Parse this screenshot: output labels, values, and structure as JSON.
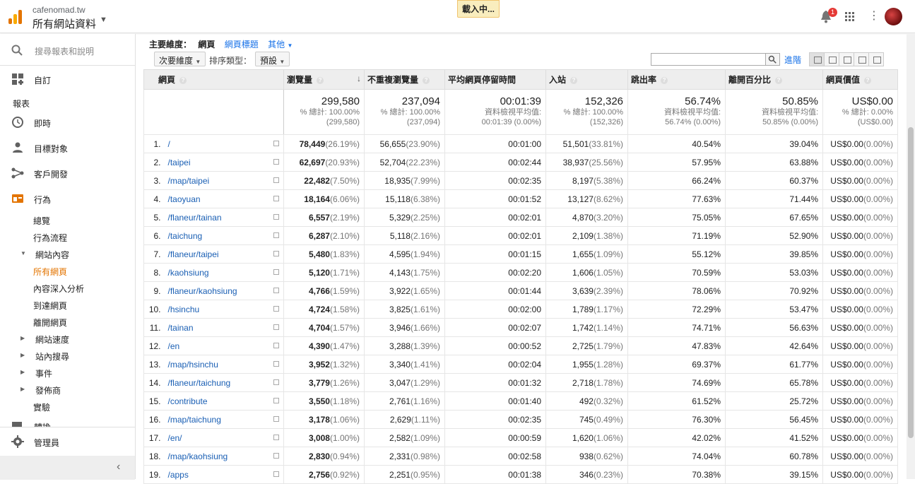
{
  "header": {
    "account": "cafenomad.tw",
    "property": "所有網站資料",
    "loading": "載入中...",
    "notif_count": "1"
  },
  "sidebar": {
    "search_placeholder": "搜尋報表和說明",
    "customize": "自訂",
    "reports_title": "報表",
    "realtime": "即時",
    "audience": "目標對象",
    "acquisition": "客戶開發",
    "behavior": "行為",
    "behavior_items": [
      "總覽",
      "行為流程",
      "網站內容",
      "所有網頁",
      "內容深入分析",
      "到達網頁",
      "離開網頁",
      "網站速度",
      "站內搜尋",
      "事件",
      "發佈商",
      "實驗"
    ],
    "conversions_partial": "轉換",
    "admin": "管理員"
  },
  "toolbar": {
    "primary_dim_label": "主要維度：",
    "primary_dim_current": "網頁",
    "primary_dim_alt": "網頁標題",
    "primary_dim_other": "其他",
    "secondary_dim": "次要維度",
    "sort_label": "排序類型：",
    "sort_value": "預設",
    "advanced": "進階"
  },
  "table": {
    "headers": [
      "網頁",
      "瀏覽量",
      "不重複瀏覽量",
      "平均網頁停留時間",
      "入站",
      "跳出率",
      "離開百分比",
      "網頁價值"
    ],
    "totals": {
      "pageviews": "299,580",
      "pageviews_sub1": "% 總計: 100.00%",
      "pageviews_sub2": "(299,580)",
      "unique": "237,094",
      "unique_sub1": "% 總計: 100.00%",
      "unique_sub2": "(237,094)",
      "avgtime": "00:01:39",
      "avgtime_sub1": "資料檢視平均值:",
      "avgtime_sub2": "00:01:39 (0.00%)",
      "entrances": "152,326",
      "entrances_sub1": "% 總計: 100.00%",
      "entrances_sub2": "(152,326)",
      "bounce": "56.74%",
      "bounce_sub1": "資料檢視平均值:",
      "bounce_sub2": "56.74% (0.00%)",
      "exit": "50.85%",
      "exit_sub1": "資料檢視平均值:",
      "exit_sub2": "50.85% (0.00%)",
      "value": "US$0.00",
      "value_sub1": "% 總計: 0.00%",
      "value_sub2": "(US$0.00)"
    },
    "rows": [
      {
        "idx": "1.",
        "page": "/",
        "pv": "78,449",
        "pvp": "(26.19%)",
        "up": "56,655",
        "upp": "(23.90%)",
        "t": "00:01:00",
        "en": "51,501",
        "enp": "(33.81%)",
        "br": "40.54%",
        "ex": "39.04%",
        "v": "US$0.00",
        "vp": "(0.00%)"
      },
      {
        "idx": "2.",
        "page": "/taipei",
        "pv": "62,697",
        "pvp": "(20.93%)",
        "up": "52,704",
        "upp": "(22.23%)",
        "t": "00:02:44",
        "en": "38,937",
        "enp": "(25.56%)",
        "br": "57.95%",
        "ex": "63.88%",
        "v": "US$0.00",
        "vp": "(0.00%)"
      },
      {
        "idx": "3.",
        "page": "/map/taipei",
        "pv": "22,482",
        "pvp": "(7.50%)",
        "up": "18,935",
        "upp": "(7.99%)",
        "t": "00:02:35",
        "en": "8,197",
        "enp": "(5.38%)",
        "br": "66.24%",
        "ex": "60.37%",
        "v": "US$0.00",
        "vp": "(0.00%)"
      },
      {
        "idx": "4.",
        "page": "/taoyuan",
        "pv": "18,164",
        "pvp": "(6.06%)",
        "up": "15,118",
        "upp": "(6.38%)",
        "t": "00:01:52",
        "en": "13,127",
        "enp": "(8.62%)",
        "br": "77.63%",
        "ex": "71.44%",
        "v": "US$0.00",
        "vp": "(0.00%)"
      },
      {
        "idx": "5.",
        "page": "/flaneur/tainan",
        "pv": "6,557",
        "pvp": "(2.19%)",
        "up": "5,329",
        "upp": "(2.25%)",
        "t": "00:02:01",
        "en": "4,870",
        "enp": "(3.20%)",
        "br": "75.05%",
        "ex": "67.65%",
        "v": "US$0.00",
        "vp": "(0.00%)"
      },
      {
        "idx": "6.",
        "page": "/taichung",
        "pv": "6,287",
        "pvp": "(2.10%)",
        "up": "5,118",
        "upp": "(2.16%)",
        "t": "00:02:01",
        "en": "2,109",
        "enp": "(1.38%)",
        "br": "71.19%",
        "ex": "52.90%",
        "v": "US$0.00",
        "vp": "(0.00%)"
      },
      {
        "idx": "7.",
        "page": "/flaneur/taipei",
        "pv": "5,480",
        "pvp": "(1.83%)",
        "up": "4,595",
        "upp": "(1.94%)",
        "t": "00:01:15",
        "en": "1,655",
        "enp": "(1.09%)",
        "br": "55.12%",
        "ex": "39.85%",
        "v": "US$0.00",
        "vp": "(0.00%)"
      },
      {
        "idx": "8.",
        "page": "/kaohsiung",
        "pv": "5,120",
        "pvp": "(1.71%)",
        "up": "4,143",
        "upp": "(1.75%)",
        "t": "00:02:20",
        "en": "1,606",
        "enp": "(1.05%)",
        "br": "70.59%",
        "ex": "53.03%",
        "v": "US$0.00",
        "vp": "(0.00%)"
      },
      {
        "idx": "9.",
        "page": "/flaneur/kaohsiung",
        "pv": "4,766",
        "pvp": "(1.59%)",
        "up": "3,922",
        "upp": "(1.65%)",
        "t": "00:01:44",
        "en": "3,639",
        "enp": "(2.39%)",
        "br": "78.06%",
        "ex": "70.92%",
        "v": "US$0.00",
        "vp": "(0.00%)"
      },
      {
        "idx": "10.",
        "page": "/hsinchu",
        "pv": "4,724",
        "pvp": "(1.58%)",
        "up": "3,825",
        "upp": "(1.61%)",
        "t": "00:02:00",
        "en": "1,789",
        "enp": "(1.17%)",
        "br": "72.29%",
        "ex": "53.47%",
        "v": "US$0.00",
        "vp": "(0.00%)"
      },
      {
        "idx": "11.",
        "page": "/tainan",
        "pv": "4,704",
        "pvp": "(1.57%)",
        "up": "3,946",
        "upp": "(1.66%)",
        "t": "00:02:07",
        "en": "1,742",
        "enp": "(1.14%)",
        "br": "74.71%",
        "ex": "56.63%",
        "v": "US$0.00",
        "vp": "(0.00%)"
      },
      {
        "idx": "12.",
        "page": "/en",
        "pv": "4,390",
        "pvp": "(1.47%)",
        "up": "3,288",
        "upp": "(1.39%)",
        "t": "00:00:52",
        "en": "2,725",
        "enp": "(1.79%)",
        "br": "47.83%",
        "ex": "42.64%",
        "v": "US$0.00",
        "vp": "(0.00%)"
      },
      {
        "idx": "13.",
        "page": "/map/hsinchu",
        "pv": "3,952",
        "pvp": "(1.32%)",
        "up": "3,340",
        "upp": "(1.41%)",
        "t": "00:02:04",
        "en": "1,955",
        "enp": "(1.28%)",
        "br": "69.37%",
        "ex": "61.77%",
        "v": "US$0.00",
        "vp": "(0.00%)"
      },
      {
        "idx": "14.",
        "page": "/flaneur/taichung",
        "pv": "3,779",
        "pvp": "(1.26%)",
        "up": "3,047",
        "upp": "(1.29%)",
        "t": "00:01:32",
        "en": "2,718",
        "enp": "(1.78%)",
        "br": "74.69%",
        "ex": "65.78%",
        "v": "US$0.00",
        "vp": "(0.00%)"
      },
      {
        "idx": "15.",
        "page": "/contribute",
        "pv": "3,550",
        "pvp": "(1.18%)",
        "up": "2,761",
        "upp": "(1.16%)",
        "t": "00:01:40",
        "en": "492",
        "enp": "(0.32%)",
        "br": "61.52%",
        "ex": "25.72%",
        "v": "US$0.00",
        "vp": "(0.00%)"
      },
      {
        "idx": "16.",
        "page": "/map/taichung",
        "pv": "3,178",
        "pvp": "(1.06%)",
        "up": "2,629",
        "upp": "(1.11%)",
        "t": "00:02:35",
        "en": "745",
        "enp": "(0.49%)",
        "br": "76.30%",
        "ex": "56.45%",
        "v": "US$0.00",
        "vp": "(0.00%)"
      },
      {
        "idx": "17.",
        "page": "/en/",
        "pv": "3,008",
        "pvp": "(1.00%)",
        "up": "2,582",
        "upp": "(1.09%)",
        "t": "00:00:59",
        "en": "1,620",
        "enp": "(1.06%)",
        "br": "42.02%",
        "ex": "41.52%",
        "v": "US$0.00",
        "vp": "(0.00%)"
      },
      {
        "idx": "18.",
        "page": "/map/kaohsiung",
        "pv": "2,830",
        "pvp": "(0.94%)",
        "up": "2,331",
        "upp": "(0.98%)",
        "t": "00:02:58",
        "en": "938",
        "enp": "(0.62%)",
        "br": "74.04%",
        "ex": "60.78%",
        "v": "US$0.00",
        "vp": "(0.00%)"
      },
      {
        "idx": "19.",
        "page": "/apps",
        "pv": "2,756",
        "pvp": "(0.92%)",
        "up": "2,251",
        "upp": "(0.95%)",
        "t": "00:01:38",
        "en": "346",
        "enp": "(0.23%)",
        "br": "70.38%",
        "ex": "39.15%",
        "v": "US$0.00",
        "vp": "(0.00%)"
      }
    ]
  }
}
